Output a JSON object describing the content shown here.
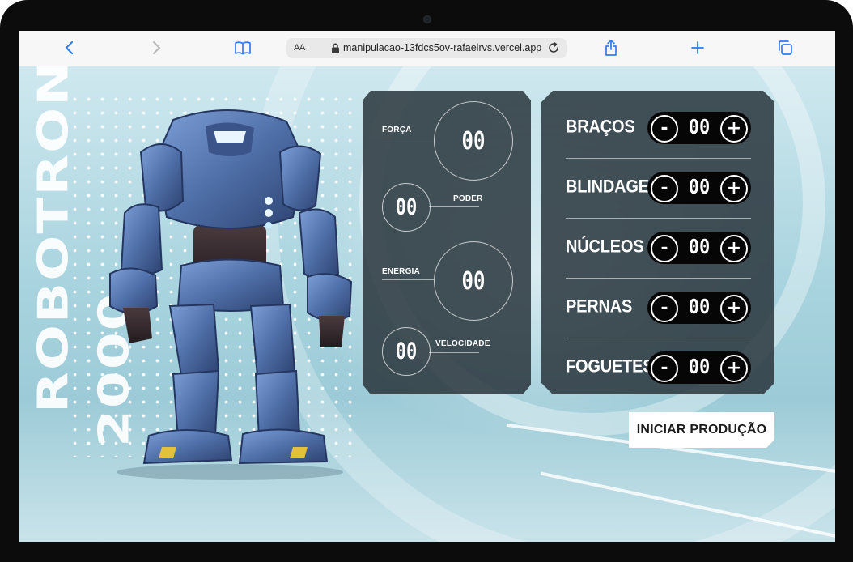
{
  "browser": {
    "reader_label": "AA",
    "url": "manipulacao-13fdcs5ov-rafaelrvs.vercel.app",
    "icons": [
      "back-icon",
      "forward-icon",
      "bookmarks-icon",
      "lock-icon",
      "reload-icon",
      "share-icon",
      "new-tab-icon",
      "tabs-icon"
    ]
  },
  "hero": {
    "title_line1": "ROBOTRON",
    "title_line2": "2000"
  },
  "stats": [
    {
      "label": "FORÇA",
      "value": "00"
    },
    {
      "label": "PODER",
      "value": "00"
    },
    {
      "label": "ENERGIA",
      "value": "00"
    },
    {
      "label": "VELOCIDADE",
      "value": "00"
    }
  ],
  "parts": [
    {
      "label": "BRAÇOS",
      "value": "00",
      "minus": "-",
      "plus": "+"
    },
    {
      "label": "BLINDAGEM",
      "value": "00",
      "minus": "-",
      "plus": "+"
    },
    {
      "label": "NÚCLEOS",
      "value": "00",
      "minus": "-",
      "plus": "+"
    },
    {
      "label": "PERNAS",
      "value": "00",
      "minus": "-",
      "plus": "+"
    },
    {
      "label": "FOGUETES",
      "value": "00",
      "minus": "-",
      "plus": "+"
    }
  ],
  "actions": {
    "start_label": "INICIAR PRODUÇÃO"
  },
  "colors": {
    "panel": "#2a363d",
    "browser_accent": "#2f7bf5",
    "robot_body": "#4f6fa8"
  }
}
